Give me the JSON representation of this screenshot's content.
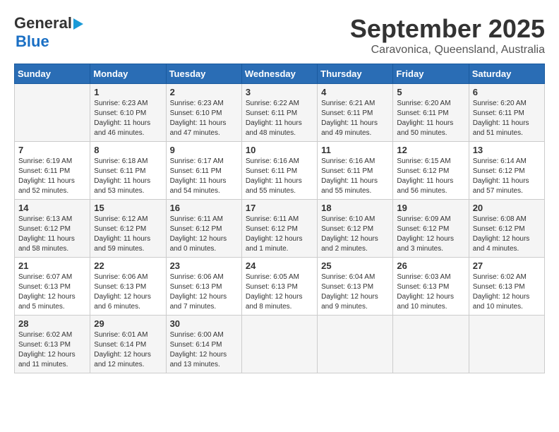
{
  "header": {
    "logo_general": "General",
    "logo_blue": "Blue",
    "month_title": "September 2025",
    "location": "Caravonica, Queensland, Australia"
  },
  "days_of_week": [
    "Sunday",
    "Monday",
    "Tuesday",
    "Wednesday",
    "Thursday",
    "Friday",
    "Saturday"
  ],
  "weeks": [
    [
      {
        "day": "",
        "sunrise": "",
        "sunset": "",
        "daylight": ""
      },
      {
        "day": "1",
        "sunrise": "Sunrise: 6:23 AM",
        "sunset": "Sunset: 6:10 PM",
        "daylight": "Daylight: 11 hours and 46 minutes."
      },
      {
        "day": "2",
        "sunrise": "Sunrise: 6:23 AM",
        "sunset": "Sunset: 6:10 PM",
        "daylight": "Daylight: 11 hours and 47 minutes."
      },
      {
        "day": "3",
        "sunrise": "Sunrise: 6:22 AM",
        "sunset": "Sunset: 6:11 PM",
        "daylight": "Daylight: 11 hours and 48 minutes."
      },
      {
        "day": "4",
        "sunrise": "Sunrise: 6:21 AM",
        "sunset": "Sunset: 6:11 PM",
        "daylight": "Daylight: 11 hours and 49 minutes."
      },
      {
        "day": "5",
        "sunrise": "Sunrise: 6:20 AM",
        "sunset": "Sunset: 6:11 PM",
        "daylight": "Daylight: 11 hours and 50 minutes."
      },
      {
        "day": "6",
        "sunrise": "Sunrise: 6:20 AM",
        "sunset": "Sunset: 6:11 PM",
        "daylight": "Daylight: 11 hours and 51 minutes."
      }
    ],
    [
      {
        "day": "7",
        "sunrise": "Sunrise: 6:19 AM",
        "sunset": "Sunset: 6:11 PM",
        "daylight": "Daylight: 11 hours and 52 minutes."
      },
      {
        "day": "8",
        "sunrise": "Sunrise: 6:18 AM",
        "sunset": "Sunset: 6:11 PM",
        "daylight": "Daylight: 11 hours and 53 minutes."
      },
      {
        "day": "9",
        "sunrise": "Sunrise: 6:17 AM",
        "sunset": "Sunset: 6:11 PM",
        "daylight": "Daylight: 11 hours and 54 minutes."
      },
      {
        "day": "10",
        "sunrise": "Sunrise: 6:16 AM",
        "sunset": "Sunset: 6:11 PM",
        "daylight": "Daylight: 11 hours and 55 minutes."
      },
      {
        "day": "11",
        "sunrise": "Sunrise: 6:16 AM",
        "sunset": "Sunset: 6:11 PM",
        "daylight": "Daylight: 11 hours and 55 minutes."
      },
      {
        "day": "12",
        "sunrise": "Sunrise: 6:15 AM",
        "sunset": "Sunset: 6:12 PM",
        "daylight": "Daylight: 11 hours and 56 minutes."
      },
      {
        "day": "13",
        "sunrise": "Sunrise: 6:14 AM",
        "sunset": "Sunset: 6:12 PM",
        "daylight": "Daylight: 11 hours and 57 minutes."
      }
    ],
    [
      {
        "day": "14",
        "sunrise": "Sunrise: 6:13 AM",
        "sunset": "Sunset: 6:12 PM",
        "daylight": "Daylight: 11 hours and 58 minutes."
      },
      {
        "day": "15",
        "sunrise": "Sunrise: 6:12 AM",
        "sunset": "Sunset: 6:12 PM",
        "daylight": "Daylight: 11 hours and 59 minutes."
      },
      {
        "day": "16",
        "sunrise": "Sunrise: 6:11 AM",
        "sunset": "Sunset: 6:12 PM",
        "daylight": "Daylight: 12 hours and 0 minutes."
      },
      {
        "day": "17",
        "sunrise": "Sunrise: 6:11 AM",
        "sunset": "Sunset: 6:12 PM",
        "daylight": "Daylight: 12 hours and 1 minute."
      },
      {
        "day": "18",
        "sunrise": "Sunrise: 6:10 AM",
        "sunset": "Sunset: 6:12 PM",
        "daylight": "Daylight: 12 hours and 2 minutes."
      },
      {
        "day": "19",
        "sunrise": "Sunrise: 6:09 AM",
        "sunset": "Sunset: 6:12 PM",
        "daylight": "Daylight: 12 hours and 3 minutes."
      },
      {
        "day": "20",
        "sunrise": "Sunrise: 6:08 AM",
        "sunset": "Sunset: 6:12 PM",
        "daylight": "Daylight: 12 hours and 4 minutes."
      }
    ],
    [
      {
        "day": "21",
        "sunrise": "Sunrise: 6:07 AM",
        "sunset": "Sunset: 6:13 PM",
        "daylight": "Daylight: 12 hours and 5 minutes."
      },
      {
        "day": "22",
        "sunrise": "Sunrise: 6:06 AM",
        "sunset": "Sunset: 6:13 PM",
        "daylight": "Daylight: 12 hours and 6 minutes."
      },
      {
        "day": "23",
        "sunrise": "Sunrise: 6:06 AM",
        "sunset": "Sunset: 6:13 PM",
        "daylight": "Daylight: 12 hours and 7 minutes."
      },
      {
        "day": "24",
        "sunrise": "Sunrise: 6:05 AM",
        "sunset": "Sunset: 6:13 PM",
        "daylight": "Daylight: 12 hours and 8 minutes."
      },
      {
        "day": "25",
        "sunrise": "Sunrise: 6:04 AM",
        "sunset": "Sunset: 6:13 PM",
        "daylight": "Daylight: 12 hours and 9 minutes."
      },
      {
        "day": "26",
        "sunrise": "Sunrise: 6:03 AM",
        "sunset": "Sunset: 6:13 PM",
        "daylight": "Daylight: 12 hours and 10 minutes."
      },
      {
        "day": "27",
        "sunrise": "Sunrise: 6:02 AM",
        "sunset": "Sunset: 6:13 PM",
        "daylight": "Daylight: 12 hours and 10 minutes."
      }
    ],
    [
      {
        "day": "28",
        "sunrise": "Sunrise: 6:02 AM",
        "sunset": "Sunset: 6:13 PM",
        "daylight": "Daylight: 12 hours and 11 minutes."
      },
      {
        "day": "29",
        "sunrise": "Sunrise: 6:01 AM",
        "sunset": "Sunset: 6:14 PM",
        "daylight": "Daylight: 12 hours and 12 minutes."
      },
      {
        "day": "30",
        "sunrise": "Sunrise: 6:00 AM",
        "sunset": "Sunset: 6:14 PM",
        "daylight": "Daylight: 12 hours and 13 minutes."
      },
      {
        "day": "",
        "sunrise": "",
        "sunset": "",
        "daylight": ""
      },
      {
        "day": "",
        "sunrise": "",
        "sunset": "",
        "daylight": ""
      },
      {
        "day": "",
        "sunrise": "",
        "sunset": "",
        "daylight": ""
      },
      {
        "day": "",
        "sunrise": "",
        "sunset": "",
        "daylight": ""
      }
    ]
  ]
}
